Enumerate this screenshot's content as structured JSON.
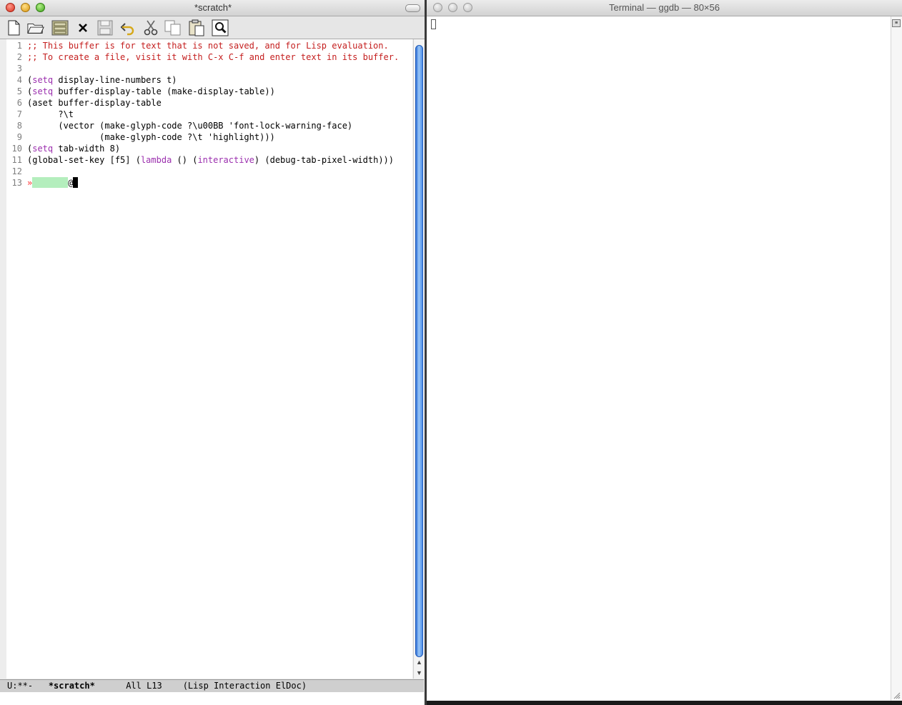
{
  "emacs": {
    "title": "*scratch*",
    "toolbar": [
      "new-file",
      "open-file",
      "open-directory",
      "kill-buffer",
      "save-buffer",
      "undo",
      "cut",
      "copy",
      "paste",
      "search"
    ],
    "lines": [
      {
        "n": "1",
        "parts": [
          {
            "t": ";; This buffer is for text that is not saved, and for Lisp evaluation.",
            "c": "cmt"
          }
        ]
      },
      {
        "n": "2",
        "parts": [
          {
            "t": ";; To create a file, visit it with C-x C-f and enter text in its buffer.",
            "c": "cmt"
          }
        ]
      },
      {
        "n": "3",
        "parts": []
      },
      {
        "n": "4",
        "parts": [
          {
            "t": "(",
            "c": ""
          },
          {
            "t": "setq",
            "c": "kw"
          },
          {
            "t": " display-line-numbers t)",
            "c": ""
          }
        ]
      },
      {
        "n": "5",
        "parts": [
          {
            "t": "(",
            "c": ""
          },
          {
            "t": "setq",
            "c": "kw"
          },
          {
            "t": " buffer-display-table (make-display-table))",
            "c": ""
          }
        ]
      },
      {
        "n": "6",
        "parts": [
          {
            "t": "(aset buffer-display-table",
            "c": ""
          }
        ]
      },
      {
        "n": "7",
        "parts": [
          {
            "t": "      ?\\t",
            "c": ""
          }
        ]
      },
      {
        "n": "8",
        "parts": [
          {
            "t": "      (vector (make-glyph-code ?\\u00BB 'font-lock-warning-face)",
            "c": ""
          }
        ]
      },
      {
        "n": "9",
        "parts": [
          {
            "t": "              (make-glyph-code ?\\t 'highlight)))",
            "c": ""
          }
        ]
      },
      {
        "n": "10",
        "parts": [
          {
            "t": "(",
            "c": ""
          },
          {
            "t": "setq",
            "c": "kw"
          },
          {
            "t": " tab-width 8)",
            "c": ""
          }
        ]
      },
      {
        "n": "11",
        "parts": [
          {
            "t": "(global-set-key [f5] (",
            "c": ""
          },
          {
            "t": "lambda",
            "c": "kw"
          },
          {
            "t": " () (",
            "c": ""
          },
          {
            "t": "interactive",
            "c": "kw"
          },
          {
            "t": ") (debug-tab-pixel-width)))",
            "c": ""
          }
        ]
      },
      {
        "n": "12",
        "parts": []
      },
      {
        "n": "13",
        "parts": [
          {
            "t": "»",
            "c": "tabglyph"
          },
          {
            "t": "",
            "c": "hl"
          },
          {
            "t": "@",
            "c": ""
          },
          {
            "t": "",
            "c": "cursor"
          }
        ]
      }
    ],
    "modeline": {
      "status": "U:**-",
      "buffer": "*scratch*",
      "position": "All L13",
      "modes": "(Lisp Interaction ElDoc)"
    }
  },
  "terminal": {
    "title": "Terminal — ggdb — 80×56"
  }
}
